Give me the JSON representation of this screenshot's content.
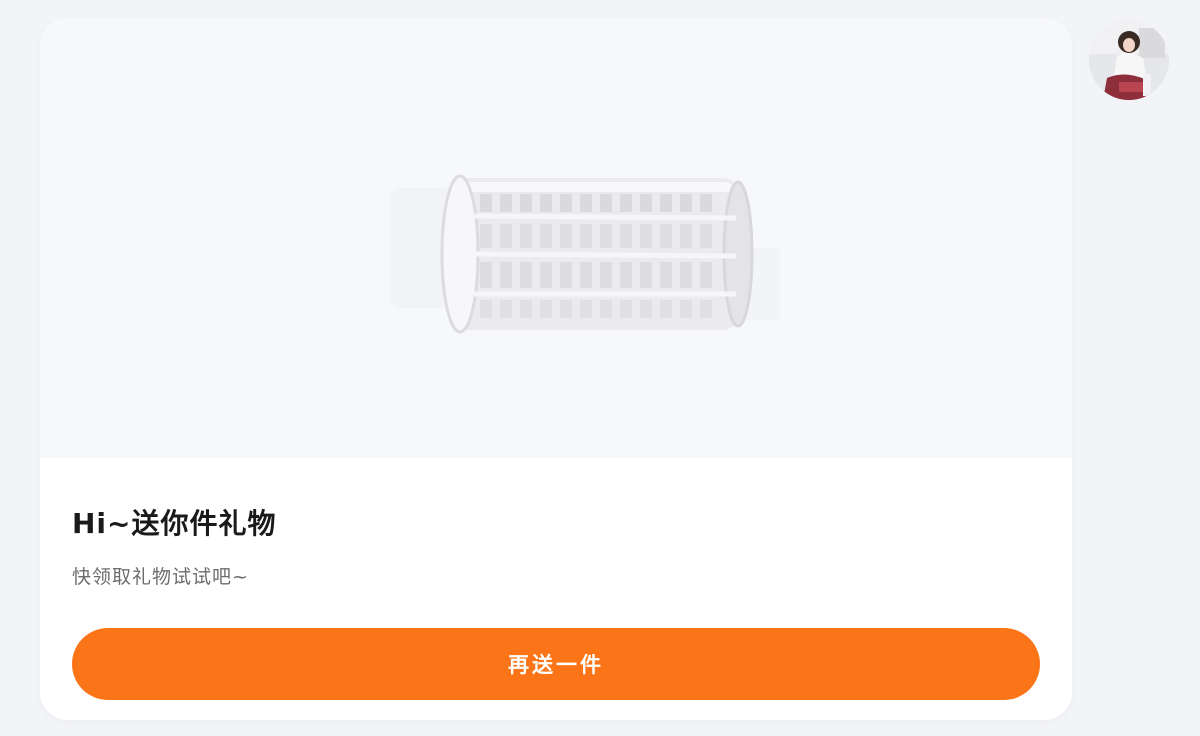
{
  "gift_card": {
    "title": "Hi~送你件礼物",
    "subtitle": "快领取礼物试试吧~",
    "action_button_label": "再送一件",
    "gift_icon": "cylindrical-cage-gift-icon"
  },
  "user": {
    "avatar_icon": "user-avatar-photo"
  },
  "colors": {
    "page_background": "#f3f4f8",
    "card_background": "#ffffff",
    "preview_background": "#f7f8fc",
    "button_background": "#fb7417",
    "title_text": "#1a1a1a",
    "subtitle_text": "#6d6d6d"
  }
}
